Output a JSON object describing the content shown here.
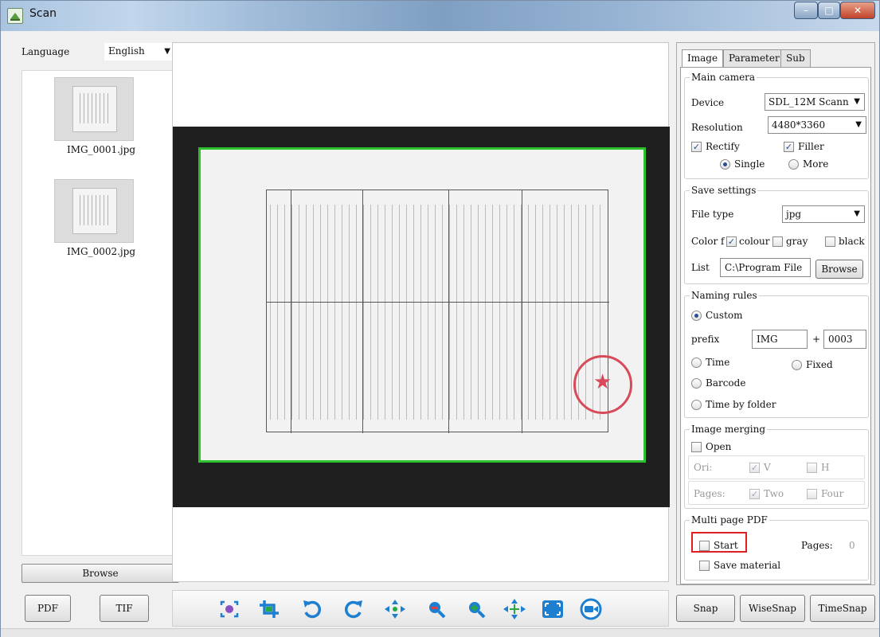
{
  "window": {
    "title": "Scan"
  },
  "left": {
    "language_label": "Language",
    "language_value": "English",
    "thumbnails": [
      {
        "name": "IMG_0001.jpg"
      },
      {
        "name": "IMG_0002.jpg"
      }
    ],
    "browse_label": "Browse"
  },
  "right": {
    "tabs": [
      "Image",
      "Parameter",
      "Sub"
    ],
    "main_camera": {
      "title": "Main camera",
      "device_label": "Device",
      "device_value": "SDL_12M Scann",
      "resolution_label": "Resolution",
      "resolution_value": "4480*3360",
      "rectify_label": "Rectify",
      "filler_label": "Filler",
      "single_label": "Single",
      "more_label": "More"
    },
    "save_settings": {
      "title": "Save settings",
      "file_type_label": "File type",
      "file_type_value": "jpg",
      "color_label": "Color f",
      "colour_label": "colour",
      "gray_label": "gray",
      "black_label": "black",
      "list_label": "List",
      "list_value": "C:\\Program File",
      "browse_label": "Browse"
    },
    "naming_rules": {
      "title": "Naming rules",
      "custom_label": "Custom",
      "prefix_label": "prefix",
      "prefix_value": "IMG",
      "plus": "+",
      "counter_value": "0003",
      "time_label": "Time",
      "fixed_label": "Fixed",
      "barcode_label": "Barcode",
      "time_by_folder_label": "Time by folder"
    },
    "image_merging": {
      "title": "Image merging",
      "open_label": "Open",
      "ori_label": "Ori:",
      "v_label": "V",
      "h_label": "H",
      "pages_label": "Pages:",
      "two_label": "Two",
      "four_label": "Four"
    },
    "multi_pdf": {
      "title": "Multi page PDF",
      "start_label": "Start",
      "pages_label": "Pages:",
      "pages_value": "0",
      "save_material_label": "Save material"
    }
  },
  "bottom": {
    "pdf_label": "PDF",
    "tif_label": "TIF",
    "snap_label": "Snap",
    "wisesnap_label": "WiseSnap",
    "timesnap_label": "TimeSnap"
  },
  "colors": {
    "crop_border": "#2ec12e",
    "highlight": "#e02020",
    "tool_blue": "#1e7fd0",
    "tool_green": "#27a843"
  }
}
